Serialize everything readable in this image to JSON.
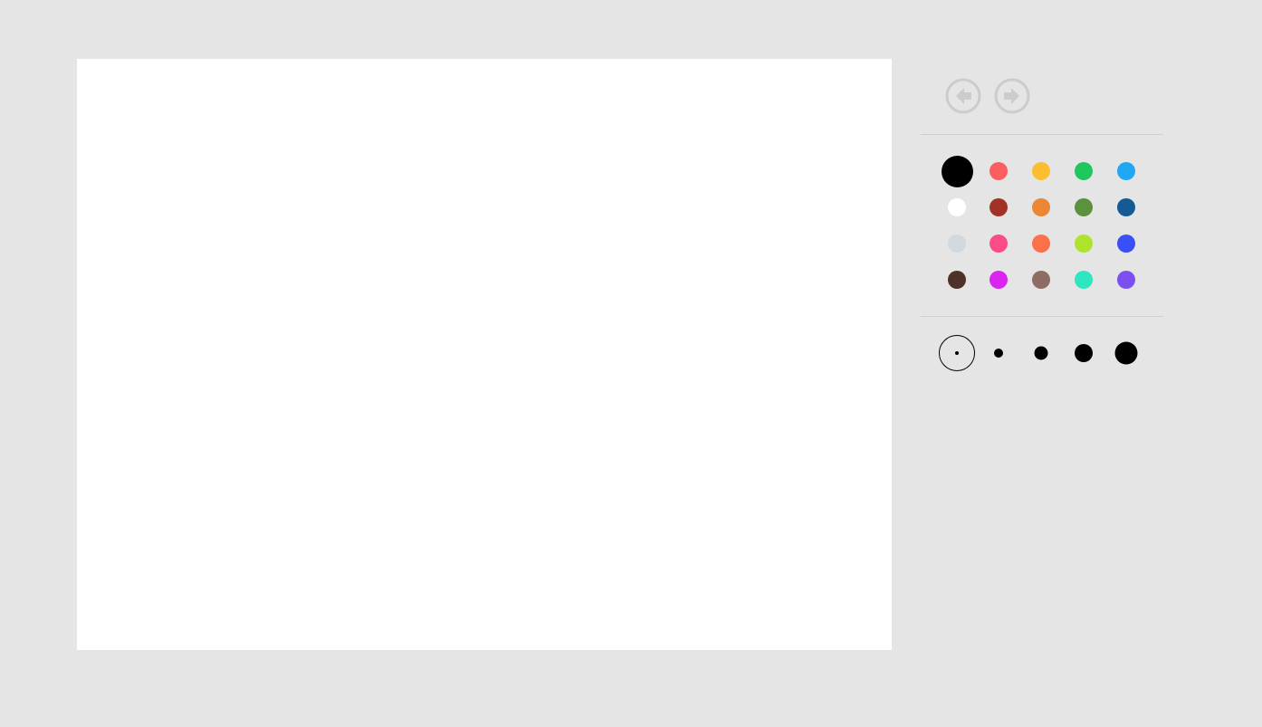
{
  "history": {
    "undo_icon": "arrow-left-circle-icon",
    "redo_icon": "arrow-right-circle-icon",
    "icon_color": "#cccccc"
  },
  "palette": {
    "selected_index": 0,
    "colors": [
      "#000000",
      "#fb5e5e",
      "#fdbd31",
      "#1fc75c",
      "#20a8f4",
      "#ffffff",
      "#a33226",
      "#ea8634",
      "#5c913e",
      "#145b96",
      "#d1d9de",
      "#fa4d85",
      "#fc714a",
      "#aee32b",
      "#3a4ff7",
      "#4e3128",
      "#d925ef",
      "#8d6c63",
      "#2ee7c0",
      "#7b4ff2"
    ]
  },
  "brush_sizes": {
    "selected_index": 0,
    "sizes": [
      4,
      10,
      15,
      20,
      25
    ]
  }
}
